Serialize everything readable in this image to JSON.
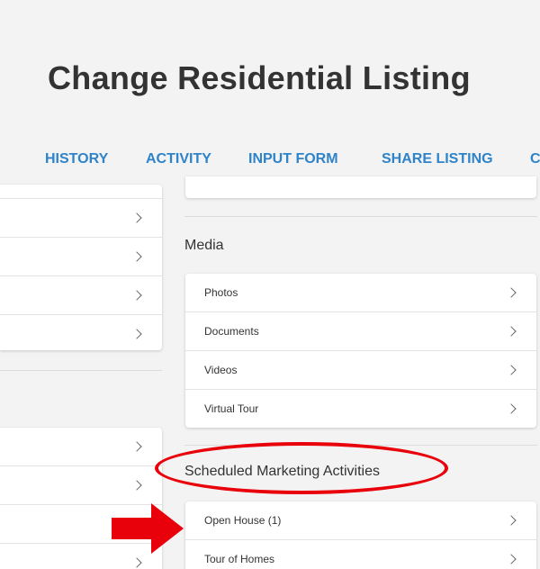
{
  "header": {
    "title": "Change Residential Listing",
    "tabs": [
      "HISTORY",
      "ACTIVITY",
      "INPUT FORM",
      "SHARE LISTING",
      "C"
    ]
  },
  "colors": {
    "background": "#f3f3f3",
    "tab_blue": "#2f83c9",
    "title_text": "#333333",
    "annotation_red": "#e8000b"
  },
  "media": {
    "title": "Media",
    "items": [
      "Photos",
      "Documents",
      "Videos",
      "Virtual Tour"
    ]
  },
  "marketing": {
    "title": "Scheduled Marketing Activities",
    "items": [
      "Open House (1)",
      "Tour of Homes"
    ]
  },
  "icons": {
    "row_chevron": "chevron-right-icon",
    "annotation_arrow": "red-arrow-icon",
    "annotation_circle": "red-ellipse-highlight"
  }
}
